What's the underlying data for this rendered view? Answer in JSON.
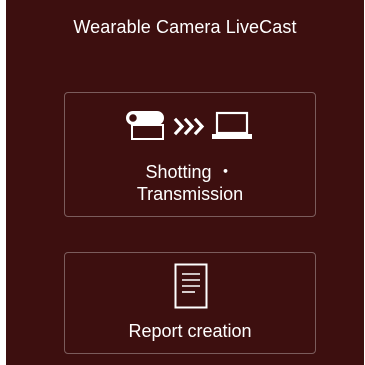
{
  "app": {
    "title": "Wearable Camera LiveCast"
  },
  "menu": {
    "shooting": {
      "line1": "Shotting ・",
      "line2": "Transmission",
      "icons": [
        "camera-icon",
        "transmit-arrows-icon",
        "laptop-icon"
      ]
    },
    "report": {
      "label": "Report creation",
      "icons": [
        "document-icon"
      ]
    }
  },
  "colors": {
    "background": "#3d0f0f",
    "text": "#ffffff",
    "card_border": "rgba(255,255,255,0.32)"
  }
}
